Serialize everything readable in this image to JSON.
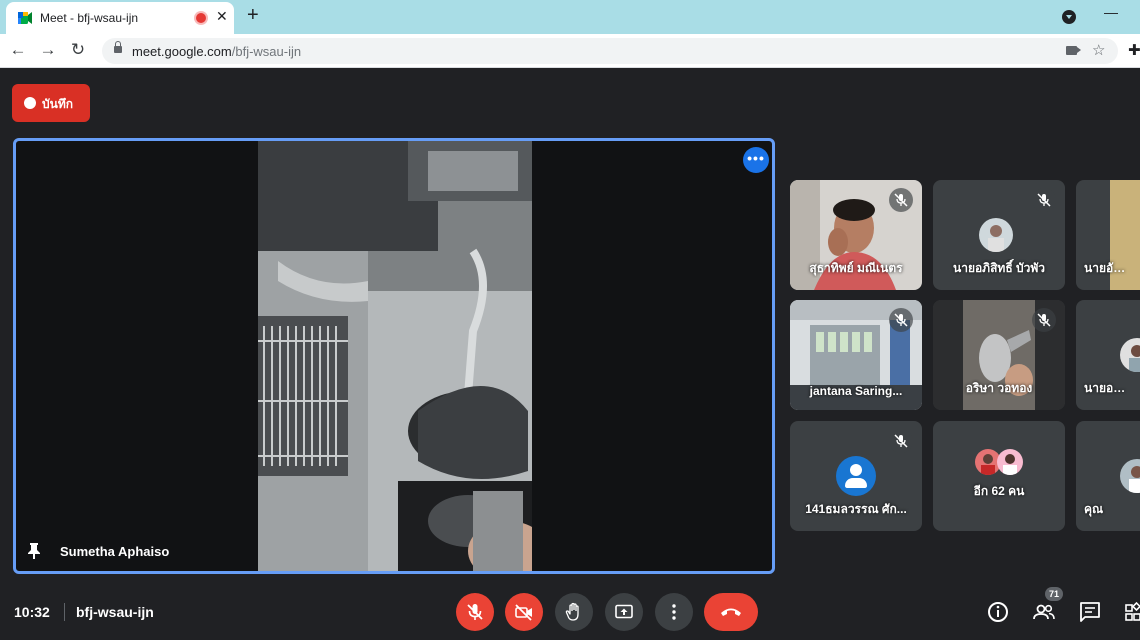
{
  "browser": {
    "tab_title": "Meet - bfj-wsau-ijn",
    "tab_close": "✕",
    "new_tab": "+",
    "back": "←",
    "forward": "→",
    "reload": "↻",
    "url_host": "meet.google.com",
    "url_path": "/bfj-wsau-ijn",
    "minimize": "—"
  },
  "recording": {
    "label": "บันทึก"
  },
  "main_video": {
    "presenter_name": "Sumetha Aphaiso",
    "more_label": "•••"
  },
  "participants": [
    {
      "name": "สุธาทิพย์ มณีเนตร",
      "muted": true,
      "kind": "video-face"
    },
    {
      "name": "นายอภิสิทธิ์ บัวพัว",
      "muted": true,
      "kind": "avatar-photo"
    },
    {
      "name": "นายอัมพ...",
      "muted": false,
      "kind": "video-partial"
    },
    {
      "name": "jantana Saring...",
      "muted": true,
      "kind": "video-room"
    },
    {
      "name": "อริษา วอทอง",
      "muted": true,
      "kind": "video-coffee"
    },
    {
      "name": "นายอภิวัต",
      "muted": false,
      "kind": "avatar-partial"
    },
    {
      "name": "141ธมลวรรณ ศัก...",
      "muted": true,
      "kind": "default-avatar"
    },
    {
      "name": "อีก 62 คน",
      "muted": false,
      "kind": "more-people"
    },
    {
      "name": "คุณ",
      "muted": false,
      "kind": "self-partial"
    }
  ],
  "bottom_bar": {
    "time": "10:32",
    "meeting_code": "bfj-wsau-ijn",
    "people_count": "71"
  },
  "colors": {
    "accent_blue": "#669df6",
    "record_red": "#d93025",
    "control_red": "#ea4335",
    "background": "#202124",
    "tile_gray": "#3c4043"
  }
}
